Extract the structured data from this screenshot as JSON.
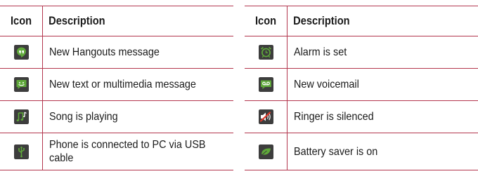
{
  "headers": {
    "icon": "Icon",
    "description": "Description"
  },
  "left_rows": [
    {
      "icon": "hangouts-message-icon",
      "description": "New Hangouts message"
    },
    {
      "icon": "text-message-icon",
      "description": "New text or multimedia message"
    },
    {
      "icon": "music-note-icon",
      "description": "Song is playing"
    },
    {
      "icon": "usb-icon",
      "description": "Phone is connected to PC via USB cable"
    }
  ],
  "right_rows": [
    {
      "icon": "alarm-clock-icon",
      "description": "Alarm is set"
    },
    {
      "icon": "voicemail-icon",
      "description": "New voicemail"
    },
    {
      "icon": "ringer-silenced-icon",
      "description": "Ringer is silenced"
    },
    {
      "icon": "battery-saver-leaf-icon",
      "description": "Battery saver is on"
    }
  ],
  "colors": {
    "rule": "#b3364d",
    "icon_bg": "#3d3d3d",
    "icon_green": "#5fa83a",
    "icon_fg": "#ffffff"
  }
}
